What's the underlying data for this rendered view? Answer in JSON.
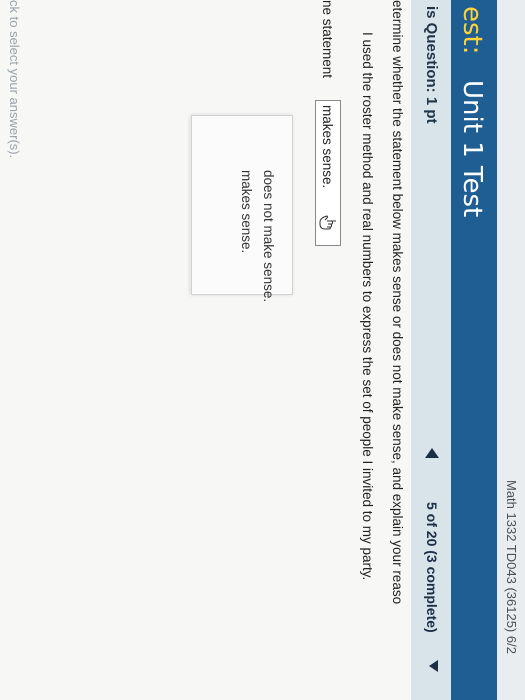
{
  "header": {
    "course": "Math 1332 TD043 (36125) 6/2",
    "title_prefix": "est:",
    "title": "Unit 1 Test"
  },
  "question_bar": {
    "points_label": "is Question: 1 pt",
    "progress": "5 of 20 (3 complete)",
    "prev_icon": "triangle-left",
    "next_icon": "triangle-down"
  },
  "question": {
    "prompt": "etermine whether the statement below makes sense or does not make sense, and explain your reaso",
    "statement": "I used the roster method and real numbers  to express the set of people I invited to my party.",
    "answer_label": "ne statement",
    "selected": "makes sense."
  },
  "dropdown": {
    "options": [
      "does not make sense.",
      "makes sense."
    ]
  },
  "footer": {
    "hint": "ck to select your answer(s)."
  },
  "colors": {
    "title_band": "#1e5e92",
    "title_prefix": "#ffd23a",
    "points_band": "#d9e3ea"
  }
}
